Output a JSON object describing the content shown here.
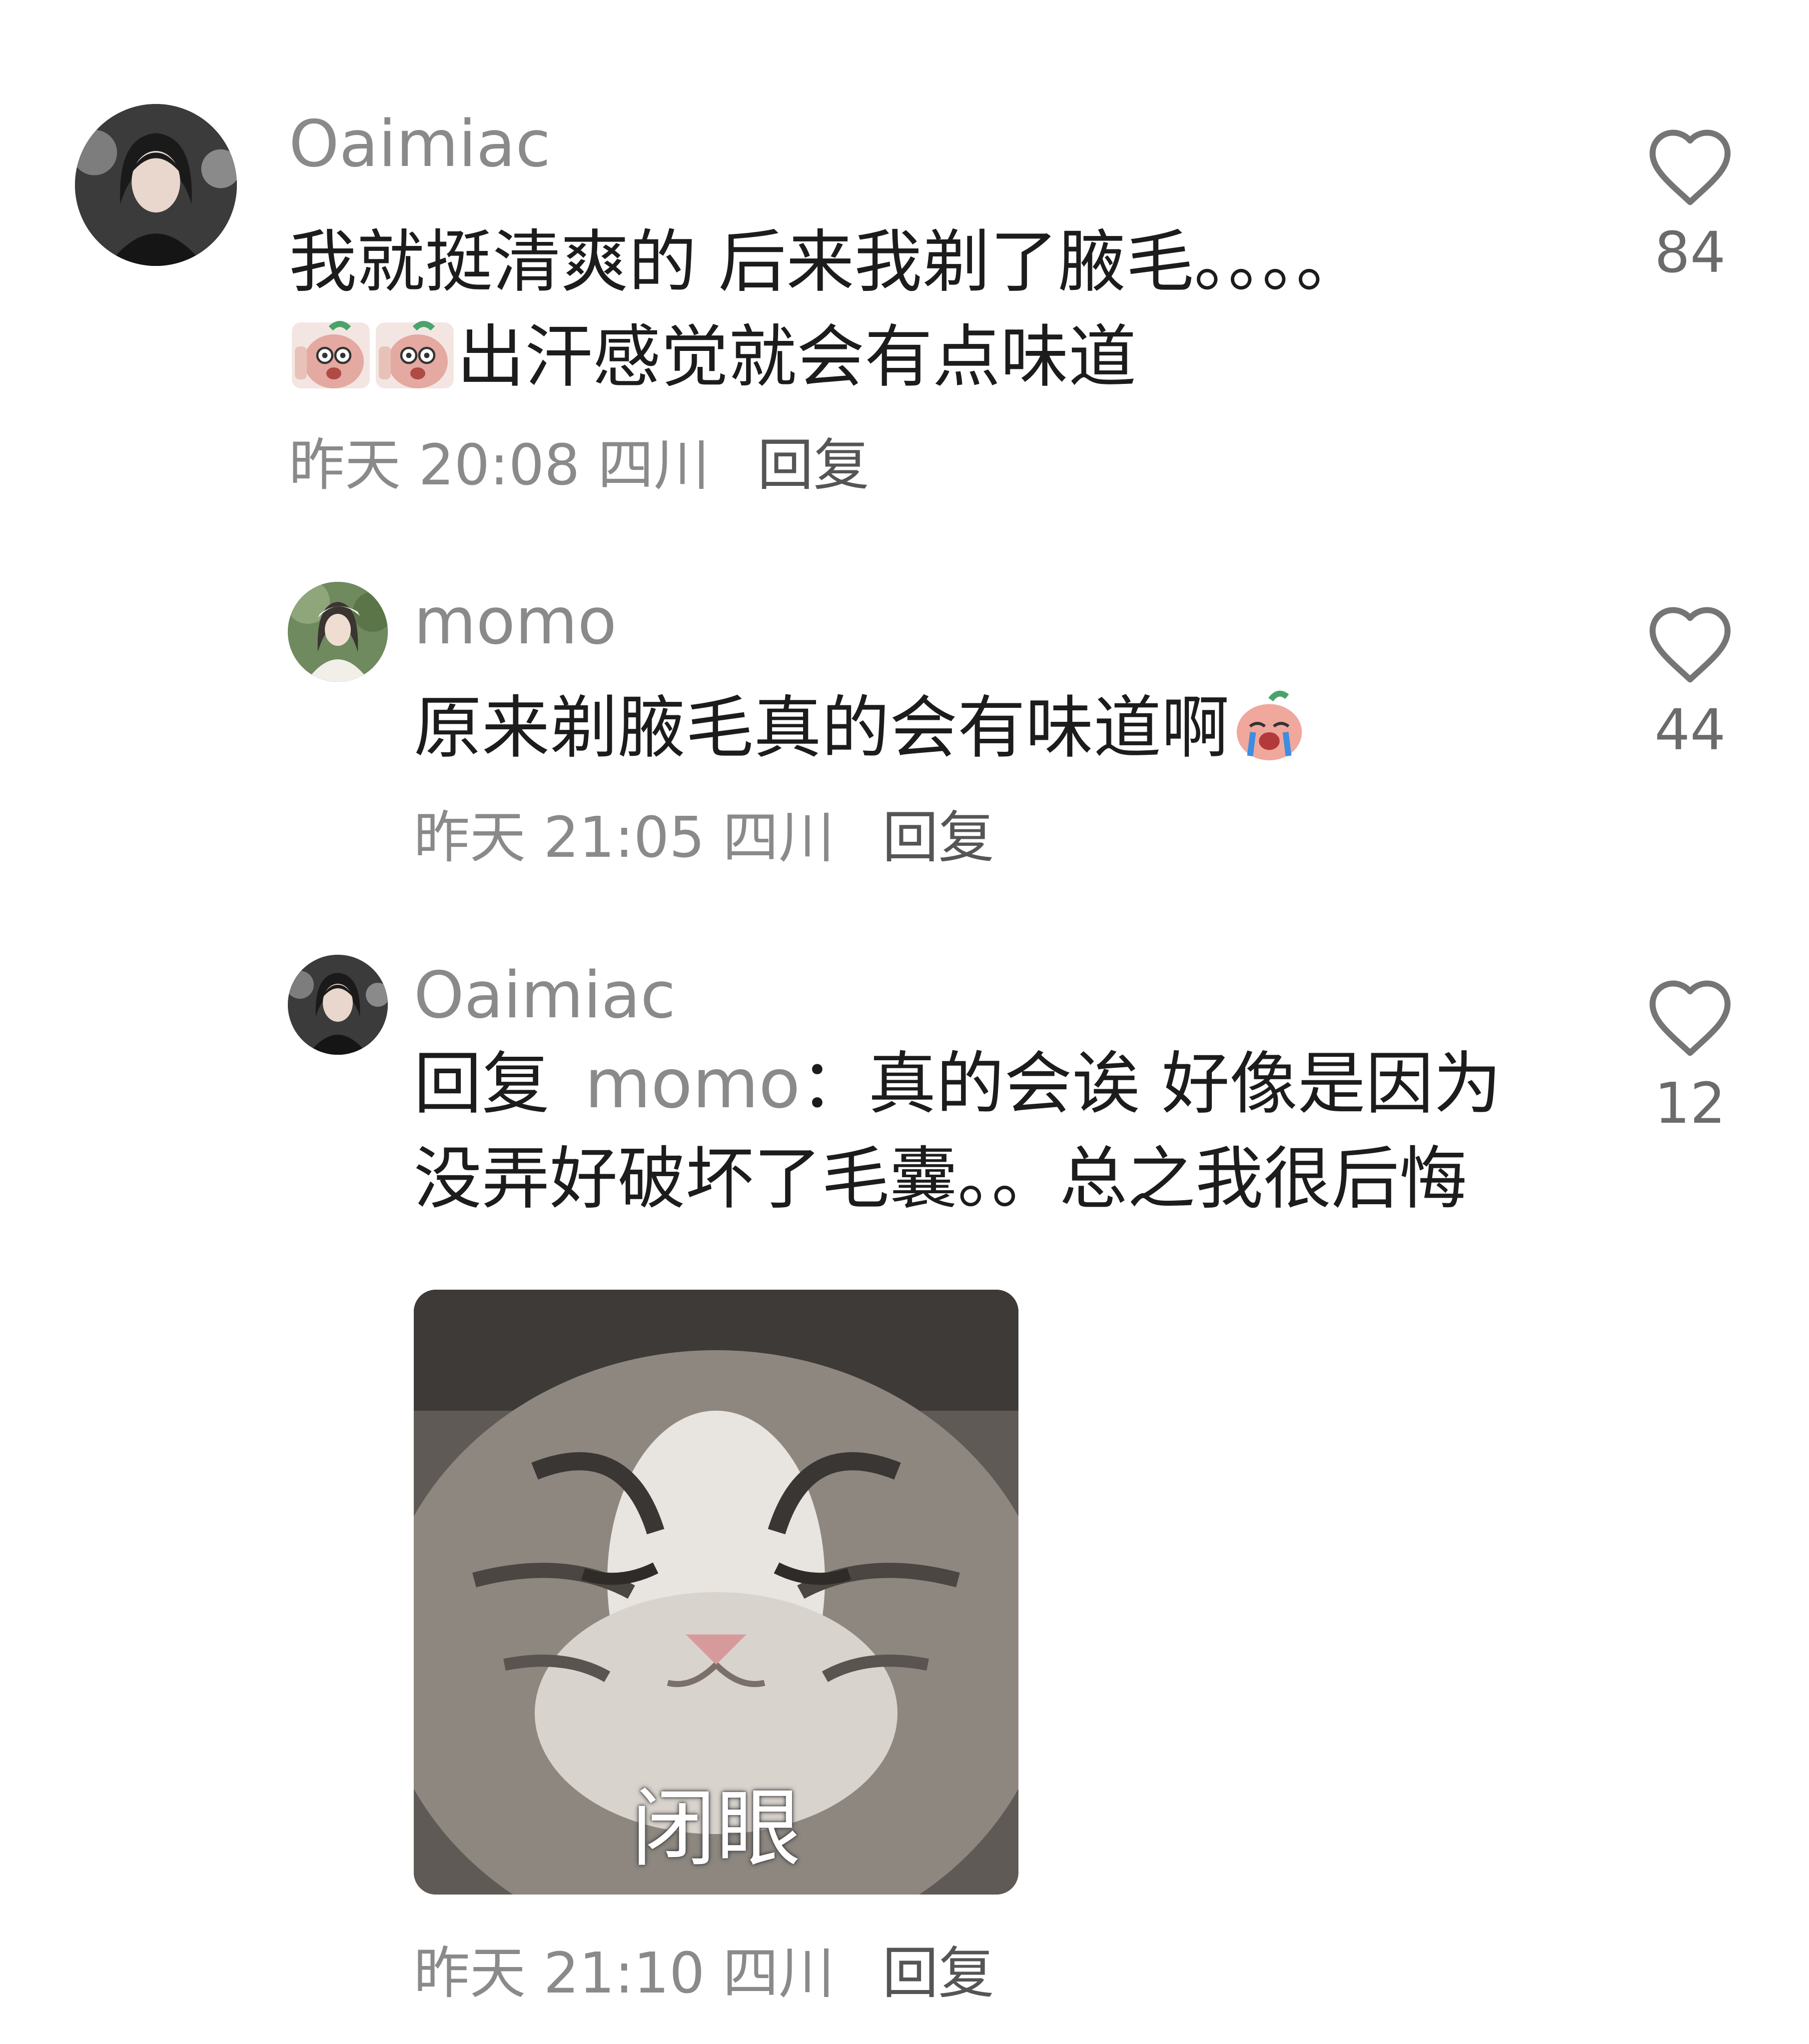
{
  "comments": [
    {
      "username": "Oaimiac",
      "lines": [
        "我就挺清爽的 后来我剃了腋毛。。。。",
        "出汗感觉就会有点味道"
      ],
      "emoji_line2": [
        "peach-emoji",
        "peach-emoji"
      ],
      "time": "昨天 20:08",
      "location": "四川",
      "reply_label": "回复",
      "likes": "84"
    },
    {
      "username": "momo",
      "text": "原来剃腋毛真的会有味道啊",
      "emoji": "crying-peach-emoji",
      "time": "昨天 21:05",
      "location": "四川",
      "reply_label": "回复",
      "likes": "44"
    },
    {
      "username": "Oaimiac",
      "reply_prefix": "回复",
      "mention": "momo",
      "line1_rest": "：真的会诶 好像是因为",
      "line2": "没弄好破坏了毛囊。。总之我很后悔",
      "sticker_caption": "闭眼",
      "time": "昨天 21:10",
      "location": "四川",
      "reply_label": "回复",
      "likes": "12"
    }
  ],
  "colors": {
    "text": "#1c1c1c",
    "secondary": "#8a8a8a",
    "background": "#ffffff"
  },
  "icons": [
    "heart-outline-icon"
  ]
}
